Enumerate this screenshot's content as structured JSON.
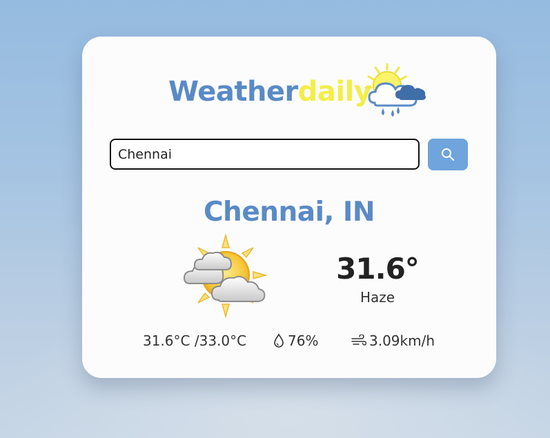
{
  "brand": {
    "name_part1": "Weather",
    "name_part2": "daily",
    "logo_icon": "sun-cloud-rain-icon",
    "colors": {
      "primary": "#5a8ac6",
      "accent": "#f3ee48"
    }
  },
  "search": {
    "value": "Chennai",
    "button_icon": "search-icon",
    "button_color": "#6fa4dc"
  },
  "weather": {
    "location": "Chennai, IN",
    "condition_icon": "sun-behind-clouds-icon",
    "temperature": "31.6°",
    "description": "Haze",
    "min_max": "31.6°C /33.0°C",
    "humidity": "76%",
    "humidity_icon": "droplet-icon",
    "wind": "3.09km/h",
    "wind_icon": "wind-icon"
  }
}
